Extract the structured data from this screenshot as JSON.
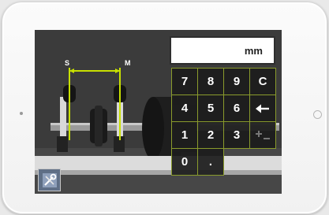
{
  "input": {
    "value": "",
    "unit": "mm"
  },
  "diagram": {
    "s_label": "S",
    "m_label": "M"
  },
  "keypad": {
    "rows": [
      [
        {
          "label": "7",
          "icon": null,
          "disabled": false
        },
        {
          "label": "8",
          "icon": null,
          "disabled": false
        },
        {
          "label": "9",
          "icon": null,
          "disabled": false
        },
        {
          "label": "C",
          "icon": null,
          "disabled": false
        }
      ],
      [
        {
          "label": "4",
          "icon": null,
          "disabled": false
        },
        {
          "label": "5",
          "icon": null,
          "disabled": false
        },
        {
          "label": "6",
          "icon": null,
          "disabled": false
        },
        {
          "label": "",
          "icon": "backspace-arrow-icon",
          "disabled": false
        }
      ],
      [
        {
          "label": "1",
          "icon": null,
          "disabled": false
        },
        {
          "label": "2",
          "icon": null,
          "disabled": false
        },
        {
          "label": "3",
          "icon": null,
          "disabled": false
        },
        {
          "label": "",
          "icon": "plus-minus-icon",
          "disabled": true
        }
      ],
      [
        {
          "label": "0",
          "icon": null,
          "disabled": false
        },
        {
          "label": ".",
          "icon": null,
          "disabled": false
        }
      ]
    ]
  },
  "tools_button": {
    "icon": "tools-icon"
  },
  "colors": {
    "key_border": "#8a9b2c",
    "measure_line": "#c8e000",
    "key_bg": "#1c1c1c",
    "disabled_text": "#6d6d6d"
  }
}
